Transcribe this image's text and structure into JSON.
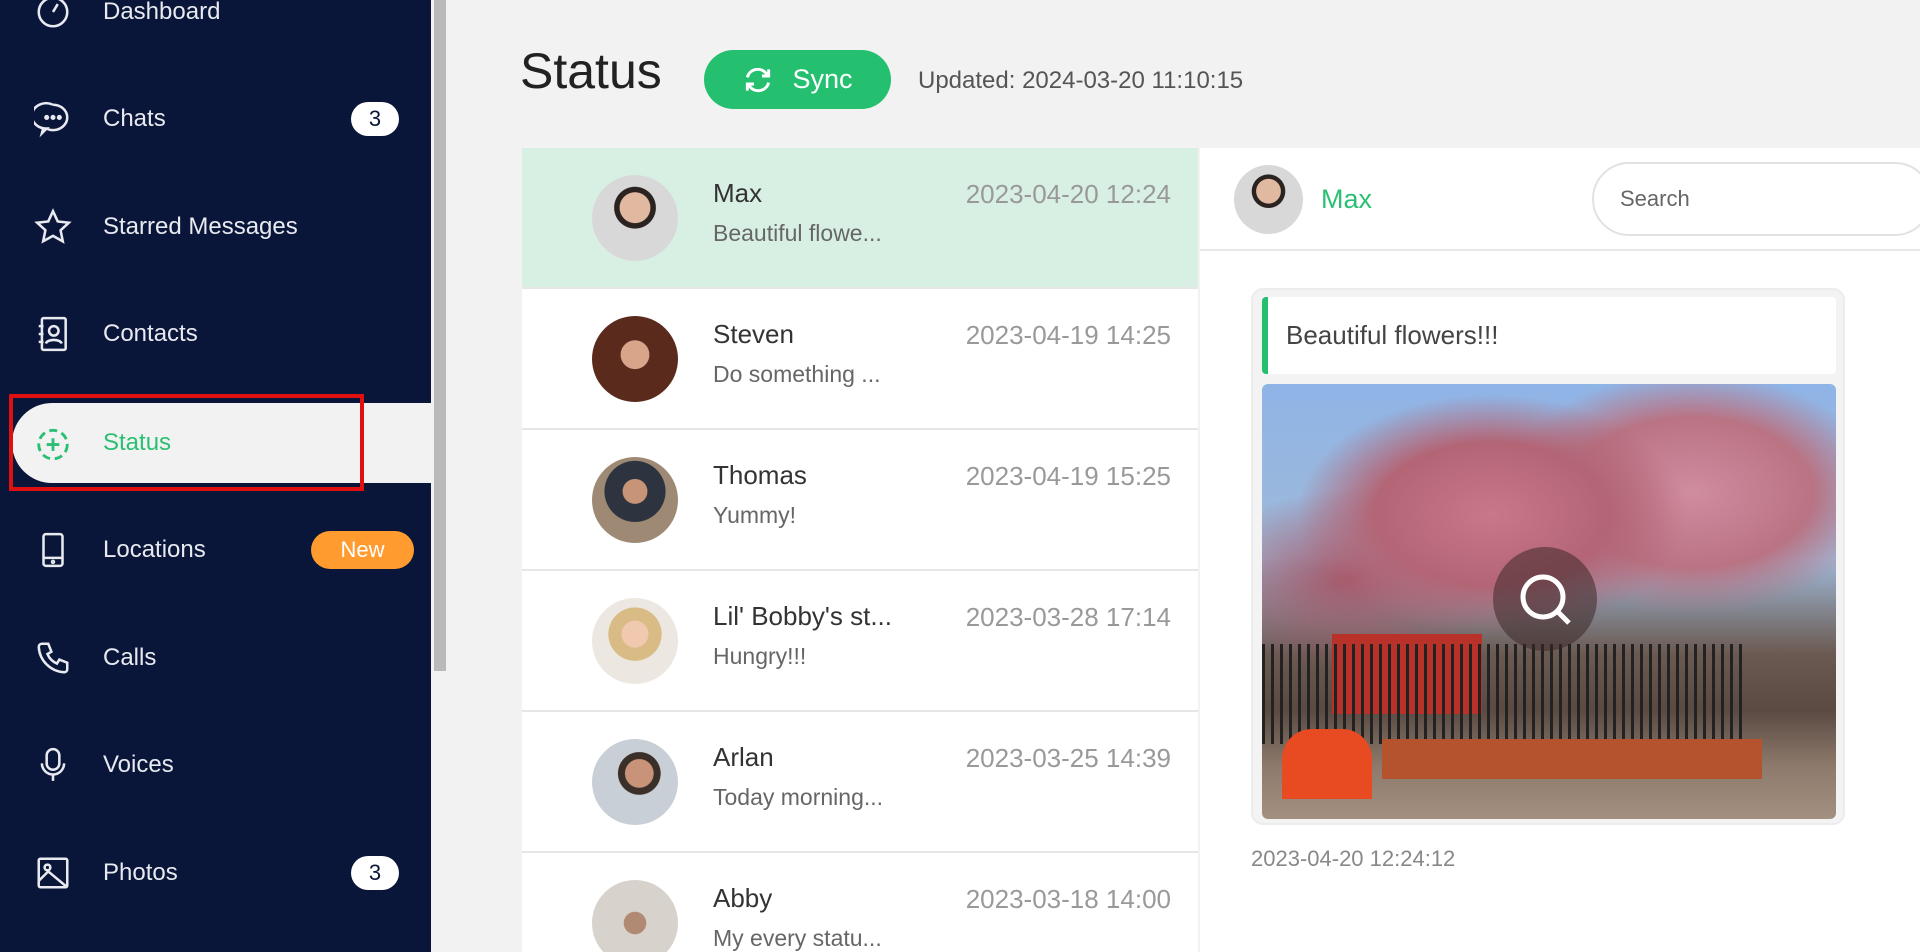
{
  "sidebar": {
    "items": [
      {
        "label": "Dashboard",
        "icon": "gauge-icon"
      },
      {
        "label": "Chats",
        "icon": "chat-icon",
        "badge": "3"
      },
      {
        "label": "Starred Messages",
        "icon": "star-icon"
      },
      {
        "label": "Contacts",
        "icon": "contact-icon"
      },
      {
        "label": "Status",
        "icon": "status-add-icon",
        "active": true
      },
      {
        "label": "Locations",
        "icon": "phone-device-icon",
        "badge": "New"
      },
      {
        "label": "Calls",
        "icon": "phone-icon"
      },
      {
        "label": "Voices",
        "icon": "microphone-icon"
      },
      {
        "label": "Photos",
        "icon": "image-icon",
        "badge": "3"
      }
    ]
  },
  "header": {
    "title": "Status",
    "sync_label": "Sync",
    "updated": "Updated: 2024-03-20 11:10:15"
  },
  "statuses": [
    {
      "name": "Max",
      "preview": "Beautiful flowe...",
      "date": "2023-04-20 12:24"
    },
    {
      "name": "Steven",
      "preview": "Do something ...",
      "date": "2023-04-19 14:25"
    },
    {
      "name": "Thomas",
      "preview": "Yummy!",
      "date": "2023-04-19 15:25"
    },
    {
      "name": "Lil' Bobby's st...",
      "preview": "Hungry!!!",
      "date": "2023-03-28 17:14"
    },
    {
      "name": "Arlan",
      "preview": "Today morning...",
      "date": "2023-03-25 14:39"
    },
    {
      "name": "Abby",
      "preview": "My every statu...",
      "date": "2023-03-18 14:00"
    }
  ],
  "detail": {
    "name": "Max",
    "search_placeholder": "Search",
    "caption": "Beautiful flowers!!!",
    "timestamp": "2023-04-20 12:24:12"
  },
  "colors": {
    "sidebar": "#0a1639",
    "accent": "#25c06f",
    "badge_new": "#ff9b2f",
    "selected_row": "#d8f0e4"
  }
}
